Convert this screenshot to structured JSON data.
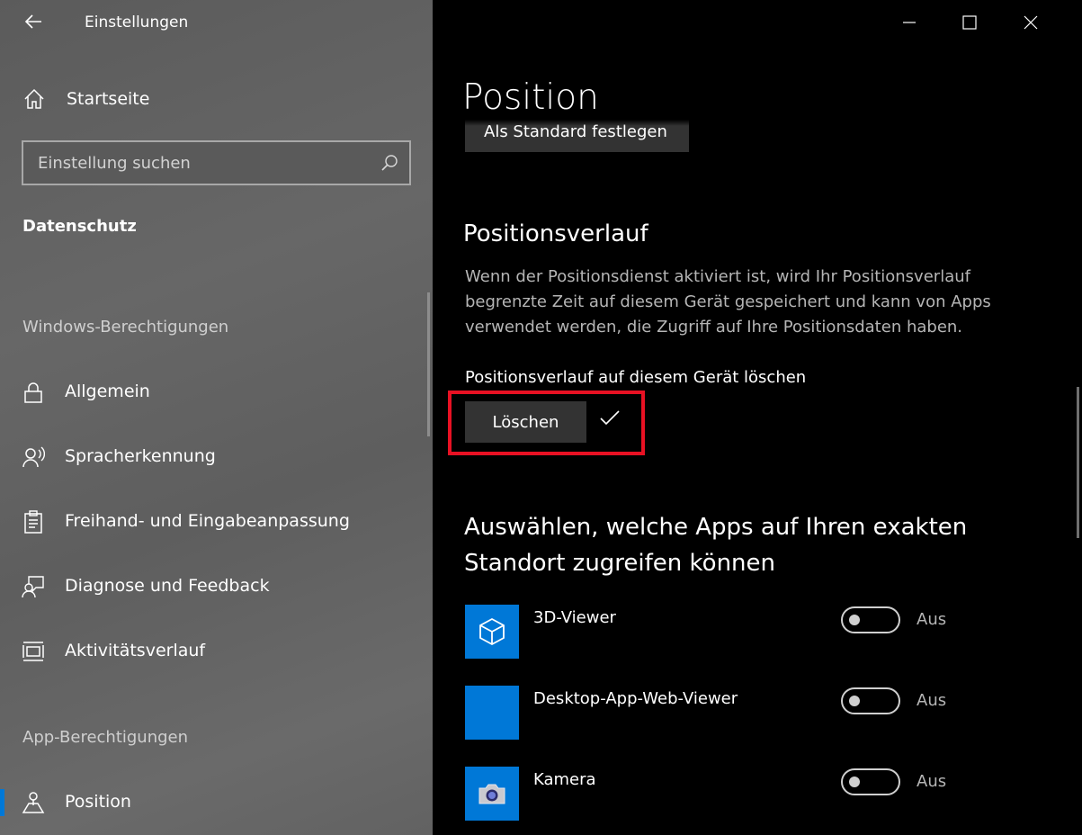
{
  "window": {
    "title": "Einstellungen"
  },
  "sidebar": {
    "home": "Startseite",
    "search": {
      "placeholder": "Einstellung suchen",
      "value": ""
    },
    "section_title": "Datenschutz",
    "group_windows": "Windows-Berechtigungen",
    "windows_items": [
      {
        "label": "Allgemein",
        "icon": "lock-icon"
      },
      {
        "label": "Spracherkennung",
        "icon": "speech-icon"
      },
      {
        "label": "Freihand- und Eingabeanpassung",
        "icon": "clipboard-icon"
      },
      {
        "label": "Diagnose und Feedback",
        "icon": "feedback-icon"
      },
      {
        "label": "Aktivitätsverlauf",
        "icon": "timeline-icon"
      }
    ],
    "group_apps": "App-Berechtigungen",
    "app_items": [
      {
        "label": "Position",
        "icon": "location-person-icon",
        "selected": true
      }
    ]
  },
  "main": {
    "page_title": "Position",
    "default_button": "Als Standard festlegen",
    "history_heading": "Positionsverlauf",
    "history_description": "Wenn der Positionsdienst aktiviert ist, wird Ihr Positionsverlauf begrenzte Zeit auf diesem Gerät gespeichert und kann von Apps verwendet werden, die Zugriff auf Ihre Positionsdaten haben.",
    "clear_label": "Positionsverlauf auf diesem Gerät löschen",
    "clear_button": "Löschen",
    "apps_heading": "Auswählen, welche Apps auf Ihren exakten Standort zugreifen können",
    "apps": [
      {
        "name": "3D-Viewer",
        "state": "Aus",
        "on": false,
        "icon": "cube-icon"
      },
      {
        "name": "Desktop-App-Web-Viewer",
        "state": "Aus",
        "on": false,
        "icon": "blank-tile-icon"
      },
      {
        "name": "Kamera",
        "state": "Aus",
        "on": false,
        "icon": "camera-icon"
      }
    ]
  },
  "colors": {
    "accent": "#0078d7",
    "highlight": "#e81123",
    "sidebar_bg": "#626262",
    "main_bg": "#000000"
  }
}
